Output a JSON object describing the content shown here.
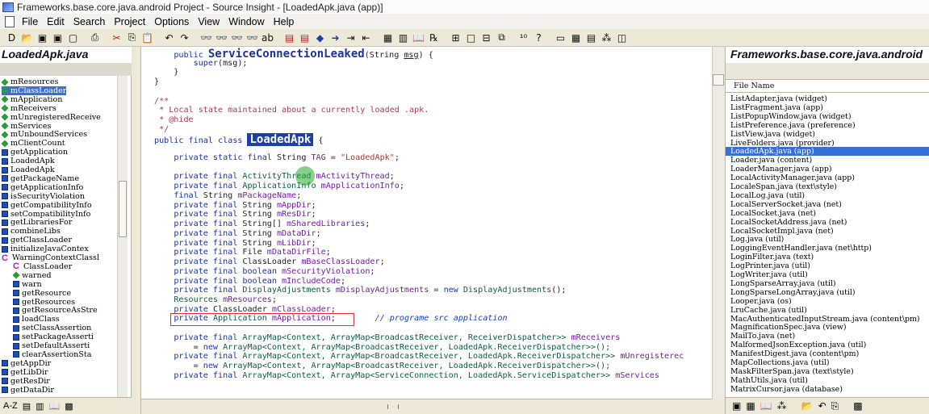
{
  "window": {
    "title": "Frameworks.base.core.java.android Project - Source Insight - [LoadedApk.java (app)]"
  },
  "menu": [
    "File",
    "Edit",
    "Search",
    "Project",
    "Options",
    "View",
    "Window",
    "Help"
  ],
  "toolbar": {
    "icons": [
      {
        "name": "new-file-icon",
        "glyph": "D"
      },
      {
        "name": "open-file-icon",
        "glyph": "📂"
      },
      {
        "name": "save-icon",
        "glyph": "▣"
      },
      {
        "name": "save-all-icon",
        "glyph": "▣"
      },
      {
        "name": "close-icon",
        "glyph": "▢"
      },
      {
        "name": "sep"
      },
      {
        "name": "print-icon",
        "glyph": "⎙"
      },
      {
        "name": "sep"
      },
      {
        "name": "cut-icon",
        "glyph": "✂",
        "color": "#c62020"
      },
      {
        "name": "copy-icon",
        "glyph": "⎘"
      },
      {
        "name": "paste-icon",
        "glyph": "📋"
      },
      {
        "name": "sep"
      },
      {
        "name": "undo-icon",
        "glyph": "↶"
      },
      {
        "name": "redo-icon",
        "glyph": "↷"
      },
      {
        "name": "sep"
      },
      {
        "name": "search-icon",
        "glyph": "👓"
      },
      {
        "name": "search-files-icon",
        "glyph": "👓"
      },
      {
        "name": "search-backward-icon",
        "glyph": "👓"
      },
      {
        "name": "search-forward-icon",
        "glyph": "👓"
      },
      {
        "name": "replace-icon",
        "glyph": "ab"
      },
      {
        "name": "sep"
      },
      {
        "name": "bookmark-icon",
        "glyph": "▤",
        "color": "#c62020"
      },
      {
        "name": "bookmark-list-icon",
        "glyph": "▤",
        "color": "#c62020"
      },
      {
        "name": "back-icon",
        "glyph": "◆",
        "color": "#1f3fa8"
      },
      {
        "name": "forward-icon",
        "glyph": "➜",
        "color": "#1f3fa8"
      },
      {
        "name": "jump-icon",
        "glyph": "⇥"
      },
      {
        "name": "jump-back-icon",
        "glyph": "⇤"
      },
      {
        "name": "sep"
      },
      {
        "name": "symbol-window-icon",
        "glyph": "▦"
      },
      {
        "name": "context-window-icon",
        "glyph": "▥"
      },
      {
        "name": "book-icon",
        "glyph": "📖"
      },
      {
        "name": "browse-icon",
        "glyph": "℞"
      },
      {
        "name": "sep"
      },
      {
        "name": "layout-grid-icon",
        "glyph": "⊞"
      },
      {
        "name": "layout-single-icon",
        "glyph": "□"
      },
      {
        "name": "layout-split-icon",
        "glyph": "⊟"
      },
      {
        "name": "layout-stack-icon",
        "glyph": "⧉"
      },
      {
        "name": "sep"
      },
      {
        "name": "relation-icon",
        "glyph": "¹⁰"
      },
      {
        "name": "help-icon",
        "glyph": "?"
      },
      {
        "name": "sep"
      },
      {
        "name": "panel-toggle-icon",
        "glyph": "▭"
      },
      {
        "name": "panel-symbol-icon",
        "glyph": "▦"
      },
      {
        "name": "panel-project-icon",
        "glyph": "▤"
      },
      {
        "name": "panel-relation-icon",
        "glyph": "⁂"
      },
      {
        "name": "panel-clip-icon",
        "glyph": "◫"
      }
    ]
  },
  "left_panel": {
    "title": "LoadedApk.java",
    "symbols": [
      {
        "label": "mResources",
        "icon": "dia"
      },
      {
        "label": "mClassLoader",
        "icon": "dia",
        "selected": true
      },
      {
        "label": "mApplication",
        "icon": "dia"
      },
      {
        "label": "mReceivers",
        "icon": "dia"
      },
      {
        "label": "mUnregisteredReceive",
        "icon": "dia"
      },
      {
        "label": "mServices",
        "icon": "dia"
      },
      {
        "label": "mUnboundServices",
        "icon": "dia"
      },
      {
        "label": "mClientCount",
        "icon": "dia"
      },
      {
        "label": "getApplication",
        "icon": "blk"
      },
      {
        "label": "LoadedApk",
        "icon": "blk"
      },
      {
        "label": "LoadedApk",
        "icon": "blk"
      },
      {
        "label": "getPackageName",
        "icon": "blk"
      },
      {
        "label": "getApplicationInfo",
        "icon": "blk"
      },
      {
        "label": "isSecurityViolation",
        "icon": "blk"
      },
      {
        "label": "getCompatibilityInfo",
        "icon": "blk"
      },
      {
        "label": "setCompatibilityInfo",
        "icon": "blk"
      },
      {
        "label": "getLibrariesFor",
        "icon": "blk"
      },
      {
        "label": "combineLibs",
        "icon": "blk"
      },
      {
        "label": "getClassLoader",
        "icon": "blk"
      },
      {
        "label": "initializeJavaContex",
        "icon": "blk"
      },
      {
        "label": "WarningContextClassl",
        "icon": "cls"
      },
      {
        "label": "ClassLoader",
        "icon": "cls",
        "indent": 1
      },
      {
        "label": "warned",
        "icon": "dia",
        "indent": 1
      },
      {
        "label": "warn",
        "icon": "blk",
        "indent": 1
      },
      {
        "label": "getResource",
        "icon": "blk",
        "indent": 1
      },
      {
        "label": "getResources",
        "icon": "blk",
        "indent": 1
      },
      {
        "label": "getResourceAsStre",
        "icon": "blk",
        "indent": 1
      },
      {
        "label": "loadClass",
        "icon": "blk",
        "indent": 1
      },
      {
        "label": "setClassAssertion",
        "icon": "blk",
        "indent": 1
      },
      {
        "label": "setPackageAsserti",
        "icon": "blk",
        "indent": 1
      },
      {
        "label": "setDefaultAsserti",
        "icon": "blk",
        "indent": 1
      },
      {
        "label": "clearAssertionSta",
        "icon": "blk",
        "indent": 1
      },
      {
        "label": "getAppDir",
        "icon": "blk"
      },
      {
        "label": "getLibDir",
        "icon": "blk"
      },
      {
        "label": "getResDir",
        "icon": "blk"
      },
      {
        "label": "getDataDir",
        "icon": "blk"
      }
    ],
    "tools": [
      {
        "name": "sort-az-icon",
        "glyph": "A-Z"
      },
      {
        "name": "list-view-icon",
        "glyph": "▤"
      },
      {
        "name": "tree-view-icon",
        "glyph": "▥"
      },
      {
        "name": "book-icon",
        "glyph": "📖"
      },
      {
        "name": "settings-icon",
        "glyph": "▩"
      }
    ]
  },
  "code": {
    "lines": [
      [
        {
          "t": "    "
        },
        {
          "t": "public ",
          "c": "k"
        },
        {
          "t": "ServiceConnectionLeaked",
          "c": "big"
        },
        {
          "t": "(String "
        },
        {
          "t": "msg",
          "u": true
        },
        {
          "t": ") {"
        }
      ],
      [
        {
          "t": "        "
        },
        {
          "t": "super",
          "c": "k"
        },
        {
          "t": "(msg);"
        }
      ],
      [
        {
          "t": "    }"
        }
      ],
      [
        {
          "t": "}"
        }
      ],
      [
        {
          "t": ""
        }
      ],
      [
        {
          "t": "/**",
          "c": "cm"
        }
      ],
      [
        {
          "t": " * Local state maintained about a currently loaded .apk.",
          "c": "cm"
        }
      ],
      [
        {
          "t": " * ",
          "c": "cm"
        },
        {
          "t": "@hide",
          "c": "cm"
        }
      ],
      [
        {
          "t": " */",
          "c": "cm"
        }
      ],
      [
        {
          "t": "public final class ",
          "c": "k"
        },
        {
          "t": "LoadedApk",
          "c": "hl"
        },
        {
          "t": " {"
        }
      ],
      [
        {
          "t": ""
        }
      ],
      [
        {
          "t": "    "
        },
        {
          "t": "private static final ",
          "c": "k"
        },
        {
          "t": "String "
        },
        {
          "t": "TAG",
          "c": "v"
        },
        {
          "t": " = "
        },
        {
          "t": "\"LoadedApk\"",
          "c": "s"
        },
        {
          "t": ";"
        }
      ],
      [
        {
          "t": ""
        }
      ],
      [
        {
          "t": "    "
        },
        {
          "t": "private final ",
          "c": "k"
        },
        {
          "t": "ActivityThread ",
          "c": "ty"
        },
        {
          "t": "mActivityThread",
          "c": "v"
        },
        {
          "t": ";"
        }
      ],
      [
        {
          "t": "    "
        },
        {
          "t": "private final ",
          "c": "k"
        },
        {
          "t": "ApplicationInfo ",
          "c": "ty"
        },
        {
          "t": "mApplicationInfo",
          "c": "v"
        },
        {
          "t": ";"
        }
      ],
      [
        {
          "t": "    "
        },
        {
          "t": "final ",
          "c": "k"
        },
        {
          "t": "String "
        },
        {
          "t": "mPackageName",
          "c": "v"
        },
        {
          "t": ";"
        }
      ],
      [
        {
          "t": "    "
        },
        {
          "t": "private final ",
          "c": "k"
        },
        {
          "t": "String "
        },
        {
          "t": "mAppDir",
          "c": "v"
        },
        {
          "t": ";"
        }
      ],
      [
        {
          "t": "    "
        },
        {
          "t": "private final ",
          "c": "k"
        },
        {
          "t": "String "
        },
        {
          "t": "mResDir",
          "c": "v"
        },
        {
          "t": ";"
        }
      ],
      [
        {
          "t": "    "
        },
        {
          "t": "private final ",
          "c": "k"
        },
        {
          "t": "String[] "
        },
        {
          "t": "mSharedLibraries",
          "c": "v"
        },
        {
          "t": ";"
        }
      ],
      [
        {
          "t": "    "
        },
        {
          "t": "private final ",
          "c": "k"
        },
        {
          "t": "String "
        },
        {
          "t": "mDataDir",
          "c": "v"
        },
        {
          "t": ";"
        }
      ],
      [
        {
          "t": "    "
        },
        {
          "t": "private final ",
          "c": "k"
        },
        {
          "t": "String "
        },
        {
          "t": "mLibDir",
          "c": "v"
        },
        {
          "t": ";"
        }
      ],
      [
        {
          "t": "    "
        },
        {
          "t": "private final ",
          "c": "k"
        },
        {
          "t": "File "
        },
        {
          "t": "mDataDirFile",
          "c": "v"
        },
        {
          "t": ";"
        }
      ],
      [
        {
          "t": "    "
        },
        {
          "t": "private final ",
          "c": "k"
        },
        {
          "t": "ClassLoader "
        },
        {
          "t": "mBaseClassLoader",
          "c": "v"
        },
        {
          "t": ";"
        }
      ],
      [
        {
          "t": "    "
        },
        {
          "t": "private final boolean ",
          "c": "k"
        },
        {
          "t": "mSecurityViolation",
          "c": "v"
        },
        {
          "t": ";"
        }
      ],
      [
        {
          "t": "    "
        },
        {
          "t": "private final boolean ",
          "c": "k"
        },
        {
          "t": "mIncludeCode",
          "c": "v"
        },
        {
          "t": ";"
        }
      ],
      [
        {
          "t": "    "
        },
        {
          "t": "private final ",
          "c": "k"
        },
        {
          "t": "DisplayAdjustments ",
          "c": "ty"
        },
        {
          "t": "mDisplayAdjustments",
          "c": "v"
        },
        {
          "t": " = "
        },
        {
          "t": "new ",
          "c": "k"
        },
        {
          "t": "DisplayAdjustments",
          "c": "ty"
        },
        {
          "t": "();"
        }
      ],
      [
        {
          "t": "    "
        },
        {
          "t": "Resources ",
          "c": "ty"
        },
        {
          "t": "mResources",
          "c": "v"
        },
        {
          "t": ";"
        }
      ],
      [
        {
          "t": "    "
        },
        {
          "t": "private ",
          "c": "k"
        },
        {
          "t": "ClassLoader "
        },
        {
          "t": "mClassLoader",
          "c": "v"
        },
        {
          "t": ";"
        }
      ],
      [
        {
          "t": "    "
        },
        {
          "t": "private ",
          "c": "k"
        },
        {
          "t": "Application ",
          "c": "ty"
        },
        {
          "t": "mApplication",
          "c": "v"
        },
        {
          "t": ";        "
        },
        {
          "t": "// programe src application",
          "c": "cmi"
        }
      ],
      [
        {
          "t": ""
        }
      ],
      [
        {
          "t": "    "
        },
        {
          "t": "private final ",
          "c": "k"
        },
        {
          "t": "ArrayMap<Context, ArrayMap<BroadcastReceiver, ReceiverDispatcher>> ",
          "c": "ty"
        },
        {
          "t": "mReceivers",
          "c": "v"
        }
      ],
      [
        {
          "t": "        = "
        },
        {
          "t": "new ",
          "c": "k"
        },
        {
          "t": "ArrayMap<Context, ArrayMap<BroadcastReceiver, LoadedApk.ReceiverDispatcher>>();",
          "c": "ty"
        }
      ],
      [
        {
          "t": "    "
        },
        {
          "t": "private final ",
          "c": "k"
        },
        {
          "t": "ArrayMap<Context, ArrayMap<BroadcastReceiver, LoadedApk.ReceiverDispatcher>> ",
          "c": "ty"
        },
        {
          "t": "mUnregisterec",
          "c": "v"
        }
      ],
      [
        {
          "t": "        = "
        },
        {
          "t": "new ",
          "c": "k"
        },
        {
          "t": "ArrayMap<Context, ArrayMap<BroadcastReceiver, LoadedApk.ReceiverDispatcher>>();",
          "c": "ty"
        }
      ],
      [
        {
          "t": "    "
        },
        {
          "t": "private final ",
          "c": "k"
        },
        {
          "t": "ArrayMap<Context, ArrayMap<ServiceConnection, LoadedApk.ServiceDispatcher>> ",
          "c": "ty"
        },
        {
          "t": "mServices",
          "c": "v"
        }
      ]
    ]
  },
  "right_panel": {
    "title": "Frameworks.base.core.java.android",
    "column_header": "File Name",
    "files": [
      "ListAdapter.java (widget)",
      "ListFragment.java (app)",
      "ListPopupWindow.java (widget)",
      "ListPreference.java (preference)",
      "ListView.java (widget)",
      "LiveFolders.java (provider)",
      "LoadedApk.java (app)",
      "Loader.java (content)",
      "LoaderManager.java (app)",
      "LocalActivityManager.java (app)",
      "LocaleSpan.java (text\\style)",
      "LocalLog.java (util)",
      "LocalServerSocket.java (net)",
      "LocalSocket.java (net)",
      "LocalSocketAddress.java (net)",
      "LocalSocketImpl.java (net)",
      "Log.java (util)",
      "LoggingEventHandler.java (net\\http)",
      "LoginFilter.java (text)",
      "LogPrinter.java (util)",
      "LogWriter.java (util)",
      "LongSparseArray.java (util)",
      "LongSparseLongArray.java (util)",
      "Looper.java (os)",
      "LruCache.java (util)",
      "MacAuthenticatedInputStream.java (content\\pm)",
      "MagnificationSpec.java (view)",
      "MailTo.java (net)",
      "MalformedJsonException.java (util)",
      "ManifestDigest.java (content\\pm)",
      "MapCollections.java (util)",
      "MaskFilterSpan.java (text\\style)",
      "MathUtils.java (util)",
      "MatrixCursor.java (database)"
    ],
    "selected_index": 6,
    "tools": [
      {
        "name": "panel-icon",
        "glyph": "▣"
      },
      {
        "name": "symbol-icon",
        "glyph": "▦"
      },
      {
        "name": "book-icon",
        "glyph": "📖"
      },
      {
        "name": "relation-icon",
        "glyph": "⁂"
      },
      {
        "name": "sep"
      },
      {
        "name": "folder-icon",
        "glyph": "📂"
      },
      {
        "name": "back-icon",
        "glyph": "↶"
      },
      {
        "name": "copy-icon",
        "glyph": "⎘"
      },
      {
        "name": "sep"
      },
      {
        "name": "settings-icon",
        "glyph": "▩"
      }
    ]
  }
}
